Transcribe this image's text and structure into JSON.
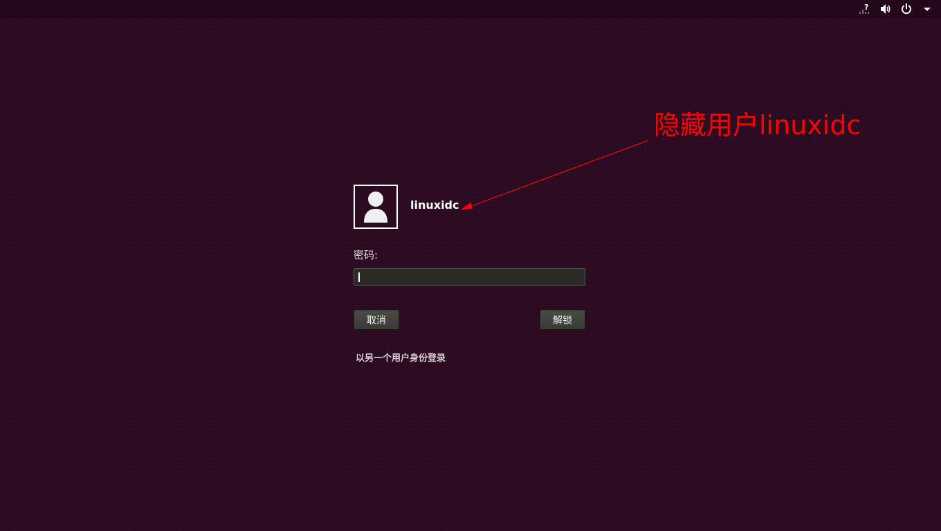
{
  "tray": {
    "network_icon": "network-unknown-icon",
    "volume_icon": "volume-icon",
    "power_icon": "power-icon",
    "menu_icon": "chevron-down-icon"
  },
  "login": {
    "username": "linuxidc",
    "password_label": "密码:",
    "password_value": "",
    "cancel_label": "取消",
    "unlock_label": "解锁",
    "other_user_link": "以另一个用户身份登录"
  },
  "annotation": {
    "text": "隐藏用户linuxidc",
    "color": "#ff0000"
  },
  "colors": {
    "background": "#2c0b22",
    "button": "#3f3f3b",
    "field": "#2a2a27"
  }
}
